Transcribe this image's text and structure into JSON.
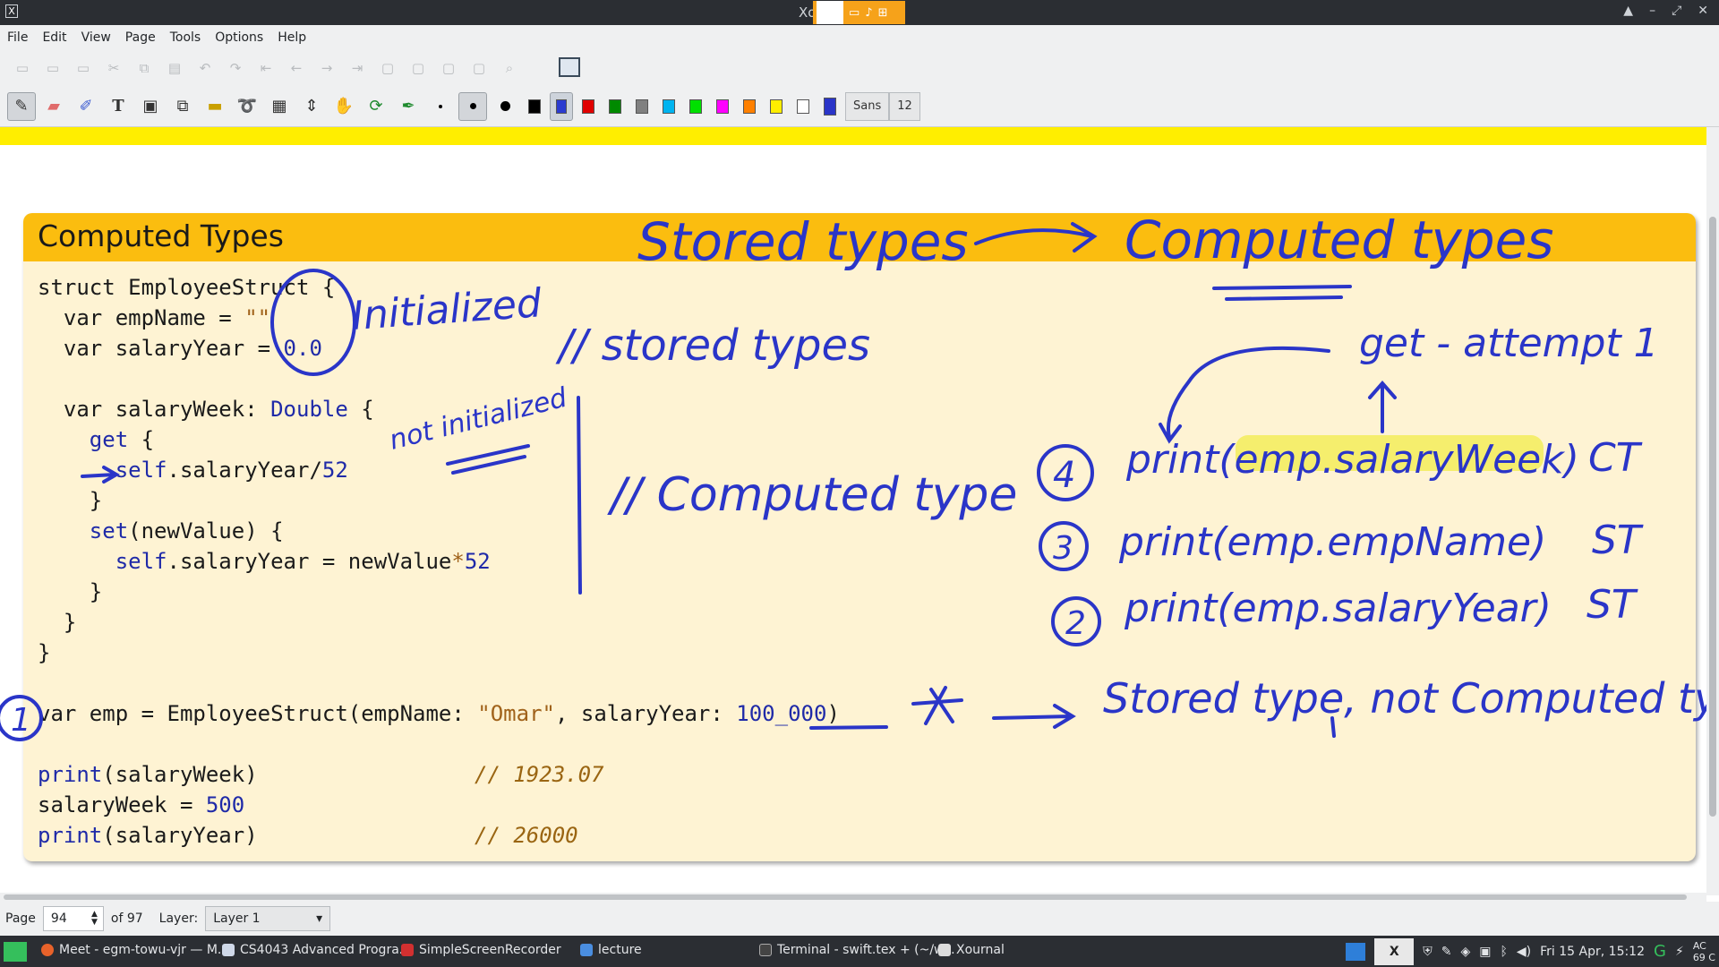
{
  "window": {
    "title": "Xo",
    "recorder_icons": [
      "camera-icon",
      "microphone-icon",
      "save-icon"
    ],
    "controls": [
      "▲",
      "–",
      "⤢",
      "✕"
    ]
  },
  "menu": [
    "File",
    "Edit",
    "View",
    "Page",
    "Tools",
    "Options",
    "Help"
  ],
  "toolbar": {
    "font_name": "Sans",
    "font_size": "12",
    "colors": [
      "#000000",
      "#2b3bd0",
      "#e00000",
      "#008a00",
      "#808080",
      "#00b4f0",
      "#00e000",
      "#ff00ff",
      "#ff8000",
      "#ffee00",
      "#ffffff"
    ],
    "current_color": "#2a35c8"
  },
  "slide": {
    "title": "Computed Types",
    "code": {
      "l1": "struct EmployeeStruct {",
      "l2a": "  var empName = ",
      "l2b": "\"\"",
      "l3a": "  var salaryYear = ",
      "l3b": "0.0",
      "l4a": "  var salaryWeek: ",
      "l4b": "Double",
      "l4c": " {",
      "l5a": "    ",
      "l5b": "get",
      "l5c": " {",
      "l6a": "      ",
      "l6b": "self",
      "l6c": ".salaryYear/",
      "l6d": "52",
      "l7": "    }",
      "l8a": "    ",
      "l8b": "set",
      "l8c": "(newValue) {",
      "l9a": "      ",
      "l9b": "self",
      "l9c": ".salaryYear = newValue",
      "l9d": "*",
      "l9e": "52",
      "l10": "    }",
      "l11": "  }",
      "l12": "}",
      "l13a": "var emp = EmployeeStruct(empName: ",
      "l13b": "\"Omar\"",
      "l13c": ", salaryYear: ",
      "l13d": "100_000",
      "l13e": ")",
      "l14a": "print",
      "l14b": "(salaryWeek)",
      "l14c": "// 1923.07",
      "l15a": "salaryWeek = ",
      "l15b": "500",
      "l16a": "print",
      "l16b": "(salaryYear)",
      "l16c": "// 26000"
    }
  },
  "annotations": {
    "a1": "Stored types",
    "a2": "Computed types",
    "a3": "Initialized",
    "a4": "// stored types",
    "a5": "not initialized",
    "a6": "// Computed type",
    "a7": "get - attempt 1",
    "a8": "4",
    "a9": "print(emp.salaryWeek)",
    "a10": "CT",
    "a11": "3",
    "a12": "print(emp.empName)",
    "a13": "ST",
    "a14": "2",
    "a15": "print(emp.salaryYear)",
    "a16": "ST",
    "a17": "1",
    "a18": "Stored type, not Computed type",
    "ink_color": "#2a35c8",
    "highlight_color": "#f3ec5a"
  },
  "status": {
    "page_label": "Page",
    "page_value": "94",
    "page_total": "of 97",
    "layer_label": "Layer:",
    "layer_value": "Layer 1"
  },
  "taskbar": {
    "tasks": [
      "Meet - egm-towu-vjr — M...",
      "CS4043 Advanced Progra...",
      "SimpleScreenRecorder",
      "lecture",
      "Terminal - swift.tex + (~/w...",
      "Xournal"
    ],
    "clock": "Fri 15 Apr, 15:12",
    "battery": "AC",
    "battery_sub": "69 C"
  }
}
